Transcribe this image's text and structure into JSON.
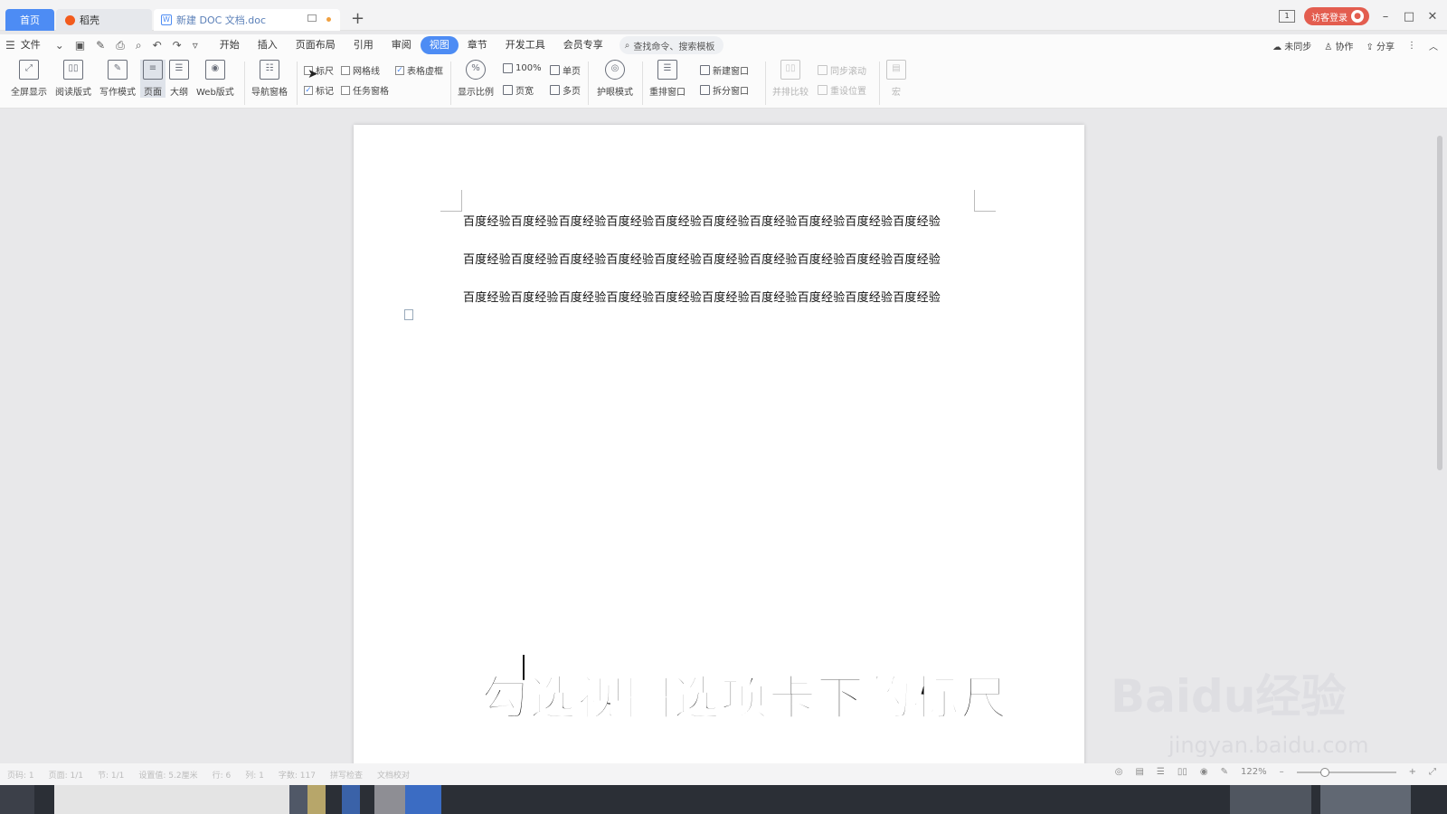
{
  "tabs": {
    "home": "首页",
    "daoke": "稻壳",
    "document": "新建 DOC 文档.doc",
    "new_tab": "+"
  },
  "window": {
    "login": "访客登录",
    "minimize": "–",
    "maximize": "□",
    "close": "✕"
  },
  "menu": {
    "file": "文件",
    "items": [
      "开始",
      "插入",
      "页面布局",
      "引用",
      "审阅",
      "视图",
      "章节",
      "开发工具",
      "会员专享"
    ],
    "active": "视图",
    "search_placeholder": "查找命令、搜索模板",
    "sync": "未同步",
    "collab": "协作",
    "share": "分享"
  },
  "ribbon": {
    "fullscreen": "全屏显示",
    "reading": "阅读版式",
    "writing": "写作模式",
    "page": "页面",
    "outline": "大纲",
    "web": "Web版式",
    "nav_pane": "导航窗格",
    "ruler": "标尺",
    "gridlines": "网格线",
    "table_gridlines": "表格虚框",
    "markup": "标记",
    "task_pane": "任务窗格",
    "zoom": "显示比例",
    "zoom_100": "100%",
    "page_width": "页宽",
    "single_page": "单页",
    "multi_page": "多页",
    "eye_mode": "护眼模式",
    "rearrange": "重排窗口",
    "new_window": "新建窗口",
    "split_window": "拆分窗口",
    "side_compare": "并排比较",
    "sync_scroll": "同步滚动",
    "reset_pos": "重设位置",
    "macro": "宏"
  },
  "checkboxes": {
    "ruler": false,
    "gridlines": false,
    "table_gridlines": true,
    "markup": true,
    "task_pane": false
  },
  "document": {
    "lines": [
      "百度经验百度经验百度经验百度经验百度经验百度经验百度经验百度经验百度经验百度经验",
      "百度经验百度经验百度经验百度经验百度经验百度经验百度经验百度经验百度经验百度经验",
      "百度经验百度经验百度经验百度经验百度经验百度经验百度经验百度经验百度经验百度经验"
    ]
  },
  "overlay": {
    "subtitle": "勾选视图选项卡下的标尺",
    "watermark": "Baidu经验",
    "watermark_url": "jingyan.baidu.com"
  },
  "status": {
    "items": [
      "页码: 1",
      "页面: 1/1",
      "节: 1/1",
      "设置值: 5.2厘米",
      "行: 6",
      "列: 1",
      "字数: 117",
      "拼写检查",
      "文档校对"
    ],
    "zoom": "122%"
  }
}
